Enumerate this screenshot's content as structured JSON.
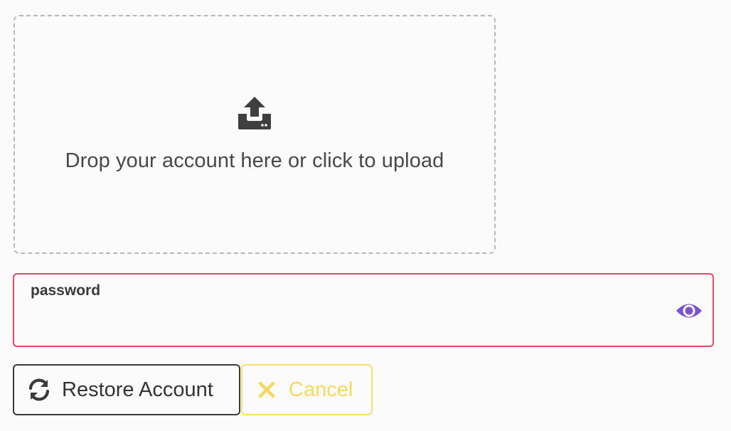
{
  "upload": {
    "prompt": "Drop your account here or click to upload",
    "icon": "upload-icon"
  },
  "password": {
    "label": "password",
    "value": "",
    "placeholder": "",
    "toggle_icon": "eye-icon"
  },
  "actions": {
    "restore_label": "Restore Account",
    "restore_icon": "sync-icon",
    "cancel_label": "Cancel",
    "cancel_icon": "close-icon"
  },
  "colors": {
    "error_border": "#e8456a",
    "eye_icon": "#7b52d6",
    "cancel": "#f8d85a",
    "text_dark": "#3a3a3a"
  }
}
